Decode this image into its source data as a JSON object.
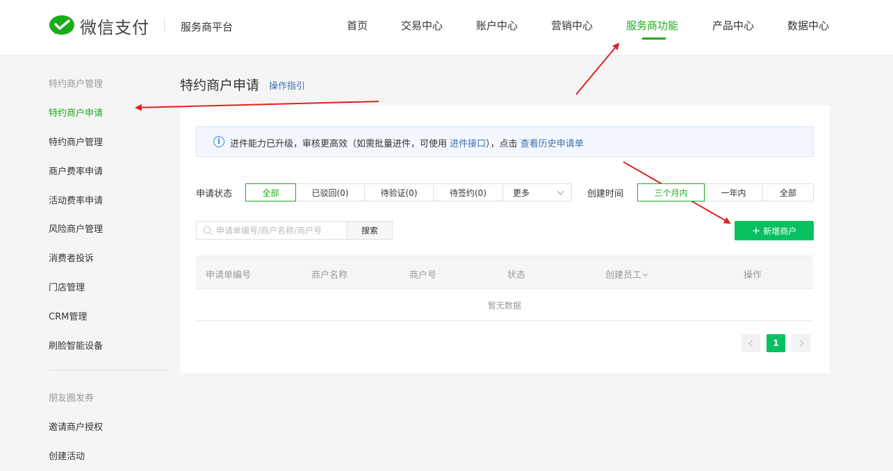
{
  "header": {
    "logo_text": "微信支付",
    "platform": "服务商平台",
    "nav": [
      "首页",
      "交易中心",
      "账户中心",
      "营销中心",
      "服务商功能",
      "产品中心",
      "数据中心"
    ],
    "active_nav": "服务商功能"
  },
  "sidebar": {
    "group1": "特约商户管理",
    "items1": [
      "特约商户申请",
      "特约商户管理",
      "商户费率申请",
      "活动费率申请",
      "风险商户管理",
      "消费者投诉",
      "门店管理",
      "CRM管理",
      "刷脸智能设备"
    ],
    "active_item": "特约商户申请",
    "group2": "朋友圈发券",
    "items2": [
      "邀请商户授权",
      "创建活动"
    ]
  },
  "main": {
    "title": "特约商户申请",
    "guide_link": "操作指引",
    "notice": {
      "text_before": "进件能力已升级，审核更高效（如需批量进件，可使用 ",
      "link1": "进件接口",
      "text_mid": "），点击 ",
      "link2": "查看历史申请单"
    },
    "status_filter": {
      "label": "申请状态",
      "options": [
        "全部",
        "已驳回(0)",
        "待验证(0)",
        "待签约(0)"
      ],
      "more": "更多",
      "active": "全部"
    },
    "time_filter": {
      "label": "创建时间",
      "options": [
        "三个月内",
        "一年内",
        "全部"
      ],
      "active": "三个月内"
    },
    "search": {
      "placeholder": "申请单编号/商户名称/商户号",
      "button": "搜索"
    },
    "add_button": "新增商户",
    "table": {
      "columns": [
        "申请单编号",
        "商户名称",
        "商户号",
        "状态",
        "创建员工",
        "操作"
      ],
      "empty_text": "暂无数据"
    },
    "pagination": {
      "current_page": "1"
    }
  },
  "colors": {
    "brand_green": "#07c160",
    "active_text": "#1aad19",
    "link_blue": "#3f6fb5",
    "annotation_red": "#e02020"
  }
}
